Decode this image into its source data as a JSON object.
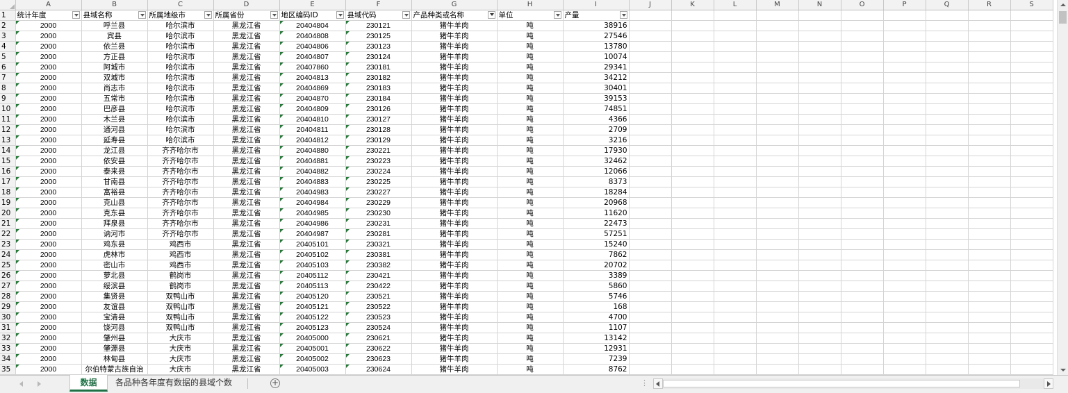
{
  "sheet": {
    "columns": [
      "A",
      "B",
      "C",
      "D",
      "E",
      "F",
      "G",
      "H",
      "I",
      "J",
      "K",
      "L",
      "M",
      "N",
      "O",
      "P",
      "Q",
      "R",
      "S"
    ],
    "headers": [
      "统计年度",
      "县域名称",
      "所属地级市",
      "所属省份",
      "地区编码ID",
      "县域代码",
      "产品种类或名称",
      "单位",
      "产量"
    ],
    "rows": [
      [
        "2000",
        "呼兰县",
        "哈尔滨市",
        "黑龙江省",
        "20404804",
        "230121",
        "猪牛羊肉",
        "吨",
        "38916"
      ],
      [
        "2000",
        "宾县",
        "哈尔滨市",
        "黑龙江省",
        "20404808",
        "230125",
        "猪牛羊肉",
        "吨",
        "27546"
      ],
      [
        "2000",
        "依兰县",
        "哈尔滨市",
        "黑龙江省",
        "20404806",
        "230123",
        "猪牛羊肉",
        "吨",
        "13780"
      ],
      [
        "2000",
        "方正县",
        "哈尔滨市",
        "黑龙江省",
        "20404807",
        "230124",
        "猪牛羊肉",
        "吨",
        "10074"
      ],
      [
        "2000",
        "阿城市",
        "哈尔滨市",
        "黑龙江省",
        "20407860",
        "230181",
        "猪牛羊肉",
        "吨",
        "29341"
      ],
      [
        "2000",
        "双城市",
        "哈尔滨市",
        "黑龙江省",
        "20404813",
        "230182",
        "猪牛羊肉",
        "吨",
        "34212"
      ],
      [
        "2000",
        "尚志市",
        "哈尔滨市",
        "黑龙江省",
        "20404869",
        "230183",
        "猪牛羊肉",
        "吨",
        "30401"
      ],
      [
        "2000",
        "五常市",
        "哈尔滨市",
        "黑龙江省",
        "20404870",
        "230184",
        "猪牛羊肉",
        "吨",
        "39153"
      ],
      [
        "2000",
        "巴彦县",
        "哈尔滨市",
        "黑龙江省",
        "20404809",
        "230126",
        "猪牛羊肉",
        "吨",
        "74851"
      ],
      [
        "2000",
        "木兰县",
        "哈尔滨市",
        "黑龙江省",
        "20404810",
        "230127",
        "猪牛羊肉",
        "吨",
        "4366"
      ],
      [
        "2000",
        "通河县",
        "哈尔滨市",
        "黑龙江省",
        "20404811",
        "230128",
        "猪牛羊肉",
        "吨",
        "2709"
      ],
      [
        "2000",
        "延寿县",
        "哈尔滨市",
        "黑龙江省",
        "20404812",
        "230129",
        "猪牛羊肉",
        "吨",
        "3216"
      ],
      [
        "2000",
        "龙江县",
        "齐齐哈尔市",
        "黑龙江省",
        "20404880",
        "230221",
        "猪牛羊肉",
        "吨",
        "17930"
      ],
      [
        "2000",
        "依安县",
        "齐齐哈尔市",
        "黑龙江省",
        "20404881",
        "230223",
        "猪牛羊肉",
        "吨",
        "32462"
      ],
      [
        "2000",
        "泰来县",
        "齐齐哈尔市",
        "黑龙江省",
        "20404882",
        "230224",
        "猪牛羊肉",
        "吨",
        "12066"
      ],
      [
        "2000",
        "甘南县",
        "齐齐哈尔市",
        "黑龙江省",
        "20404883",
        "230225",
        "猪牛羊肉",
        "吨",
        "8373"
      ],
      [
        "2000",
        "富裕县",
        "齐齐哈尔市",
        "黑龙江省",
        "20404983",
        "230227",
        "猪牛羊肉",
        "吨",
        "18284"
      ],
      [
        "2000",
        "克山县",
        "齐齐哈尔市",
        "黑龙江省",
        "20404984",
        "230229",
        "猪牛羊肉",
        "吨",
        "20968"
      ],
      [
        "2000",
        "克东县",
        "齐齐哈尔市",
        "黑龙江省",
        "20404985",
        "230230",
        "猪牛羊肉",
        "吨",
        "11620"
      ],
      [
        "2000",
        "拜泉县",
        "齐齐哈尔市",
        "黑龙江省",
        "20404986",
        "230231",
        "猪牛羊肉",
        "吨",
        "22473"
      ],
      [
        "2000",
        "讷河市",
        "齐齐哈尔市",
        "黑龙江省",
        "20404987",
        "230281",
        "猪牛羊肉",
        "吨",
        "57251"
      ],
      [
        "2000",
        "鸡东县",
        "鸡西市",
        "黑龙江省",
        "20405101",
        "230321",
        "猪牛羊肉",
        "吨",
        "15240"
      ],
      [
        "2000",
        "虎林市",
        "鸡西市",
        "黑龙江省",
        "20405102",
        "230381",
        "猪牛羊肉",
        "吨",
        "7862"
      ],
      [
        "2000",
        "密山市",
        "鸡西市",
        "黑龙江省",
        "20405103",
        "230382",
        "猪牛羊肉",
        "吨",
        "20702"
      ],
      [
        "2000",
        "萝北县",
        "鹤岗市",
        "黑龙江省",
        "20405112",
        "230421",
        "猪牛羊肉",
        "吨",
        "3389"
      ],
      [
        "2000",
        "绥滨县",
        "鹤岗市",
        "黑龙江省",
        "20405113",
        "230422",
        "猪牛羊肉",
        "吨",
        "5860"
      ],
      [
        "2000",
        "集贤县",
        "双鸭山市",
        "黑龙江省",
        "20405120",
        "230521",
        "猪牛羊肉",
        "吨",
        "5746"
      ],
      [
        "2000",
        "友谊县",
        "双鸭山市",
        "黑龙江省",
        "20405121",
        "230522",
        "猪牛羊肉",
        "吨",
        "168"
      ],
      [
        "2000",
        "宝清县",
        "双鸭山市",
        "黑龙江省",
        "20405122",
        "230523",
        "猪牛羊肉",
        "吨",
        "4700"
      ],
      [
        "2000",
        "饶河县",
        "双鸭山市",
        "黑龙江省",
        "20405123",
        "230524",
        "猪牛羊肉",
        "吨",
        "1107"
      ],
      [
        "2000",
        "肇州县",
        "大庆市",
        "黑龙江省",
        "20405000",
        "230621",
        "猪牛羊肉",
        "吨",
        "13142"
      ],
      [
        "2000",
        "肇源县",
        "大庆市",
        "黑龙江省",
        "20405001",
        "230622",
        "猪牛羊肉",
        "吨",
        "12931"
      ],
      [
        "2000",
        "林甸县",
        "大庆市",
        "黑龙江省",
        "20405002",
        "230623",
        "猪牛羊肉",
        "吨",
        "7239"
      ],
      [
        "2000",
        "尔伯特蒙古族自治",
        "大庆市",
        "黑龙江省",
        "20405003",
        "230624",
        "猪牛羊肉",
        "吨",
        "8762"
      ]
    ]
  },
  "tabs": {
    "active": "数据",
    "second": "各品种各年度有数据的县域个数",
    "add": "+"
  },
  "colors": {
    "accent": "#1e7145",
    "error_triangle": "#1e7e34",
    "gridline": "#d4d4d4",
    "header_bg": "#f2f2f2"
  },
  "icons": [
    "filter-dropdown-icon",
    "add-sheet-icon",
    "scroll-left-icon",
    "scroll-right-icon",
    "scroll-up-icon",
    "scroll-down-icon"
  ]
}
